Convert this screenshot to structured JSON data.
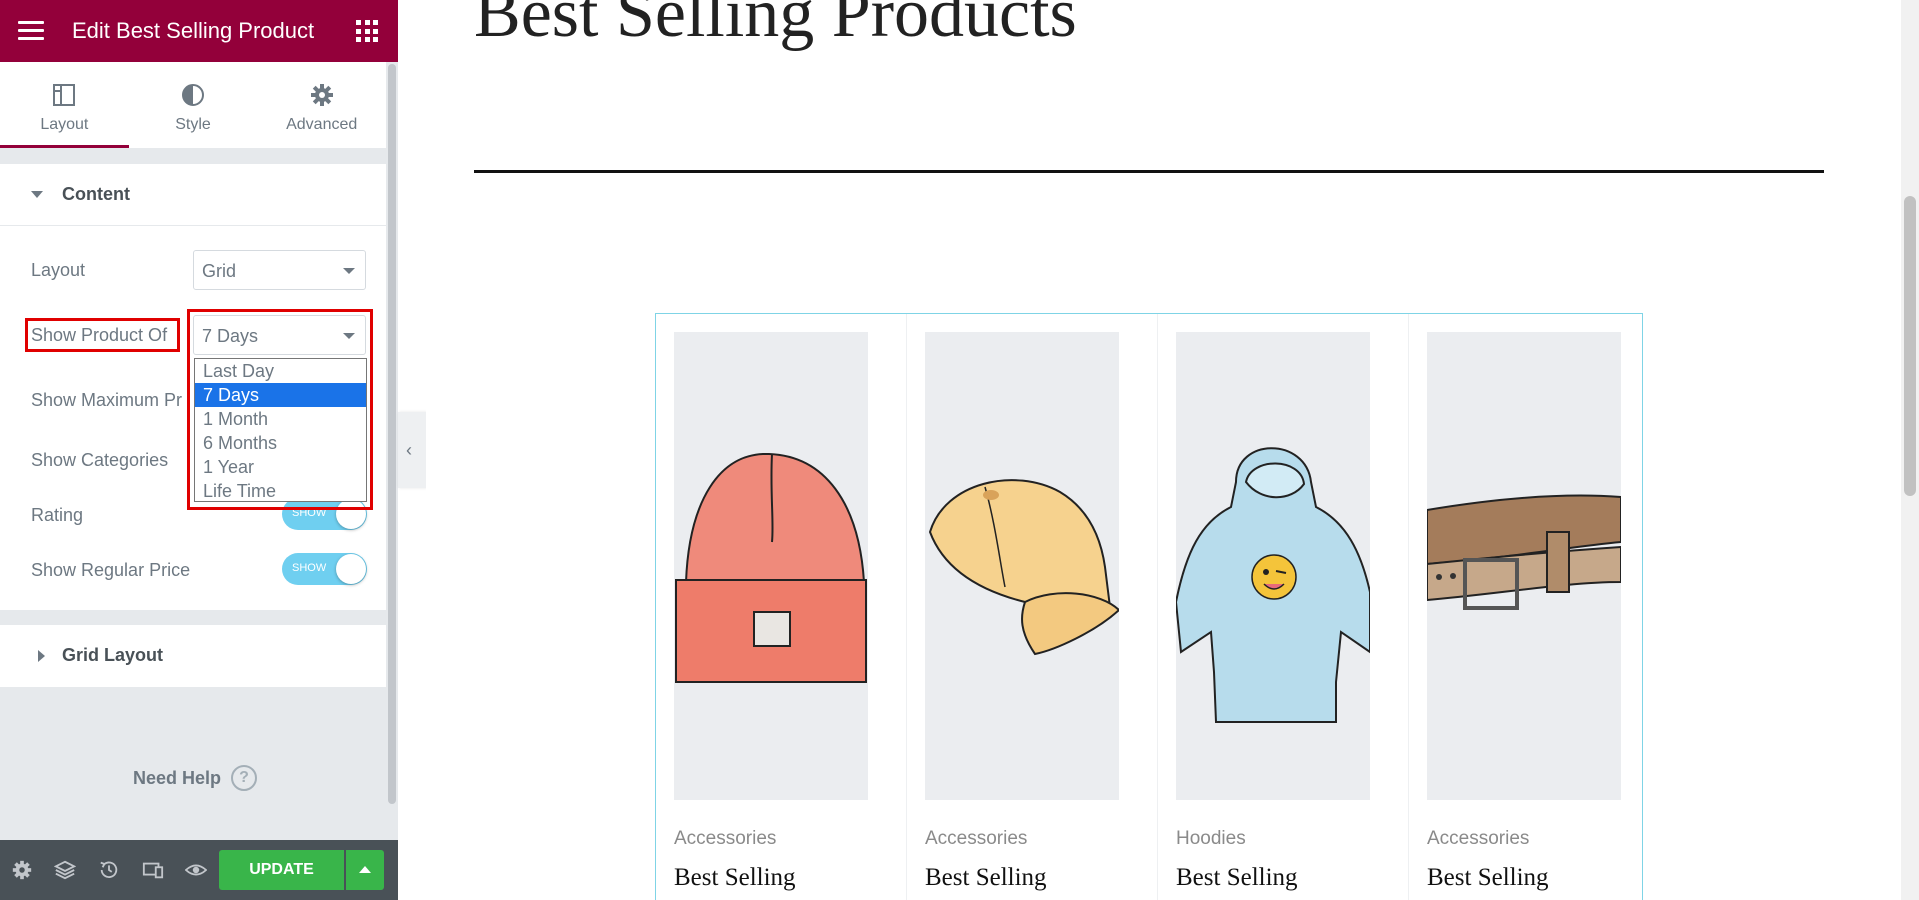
{
  "topbar": {
    "title": "Edit Best Selling Product"
  },
  "tabs": [
    {
      "label": "Layout",
      "icon": "layout-icon",
      "active": true
    },
    {
      "label": "Style",
      "icon": "contrast-icon",
      "active": false
    },
    {
      "label": "Advanced",
      "icon": "gear-icon",
      "active": false
    }
  ],
  "content_section": {
    "title": "Content",
    "layout": {
      "label": "Layout",
      "value": "Grid"
    },
    "show_product_of": {
      "label": "Show Product Of",
      "value": "7 Days",
      "options": [
        "Last Day",
        "7 Days",
        "1 Month",
        "6 Months",
        "1 Year",
        "Life Time"
      ],
      "selected_index": 1
    },
    "show_maximum": {
      "label": "Show Maximum Pr"
    },
    "show_categories": {
      "label": "Show Categories"
    },
    "rating": {
      "label": "Rating",
      "toggle_text": "SHOW"
    },
    "show_regular_price": {
      "label": "Show Regular Price",
      "toggle_text": "SHOW"
    }
  },
  "grid_section": {
    "title": "Grid Layout"
  },
  "help": {
    "label": "Need Help",
    "icon_text": "?"
  },
  "footer": {
    "update_label": "UPDATE"
  },
  "preview": {
    "heading": "Best Selling Products",
    "products": [
      {
        "category": "Accessories",
        "name": "Best Selling",
        "image": "beanie"
      },
      {
        "category": "Accessories",
        "name": "Best Selling",
        "image": "cap"
      },
      {
        "category": "Hoodies",
        "name": "Best Selling",
        "image": "hoodie"
      },
      {
        "category": "Accessories",
        "name": "Best Selling",
        "image": "belt"
      }
    ]
  },
  "colors": {
    "brand": "#93003a",
    "update": "#39b54a",
    "highlight": "#e00000",
    "selected_option": "#1a73e8",
    "toggle_on": "#6fcff0"
  }
}
